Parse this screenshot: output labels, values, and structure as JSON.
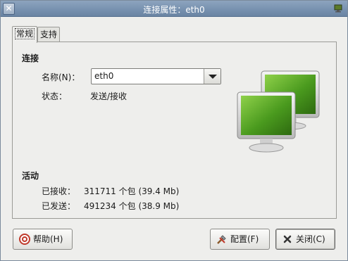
{
  "window": {
    "title": "连接属性：eth0"
  },
  "tabs": [
    {
      "label": "常规",
      "active": true
    },
    {
      "label": "支持",
      "active": false
    }
  ],
  "connection": {
    "section_title": "连接",
    "name_label": "名称(N)：",
    "name_value": "eth0",
    "status_label": "状态：",
    "status_value": "发送/接收"
  },
  "activity": {
    "section_title": "活动",
    "received_label": "已接收：",
    "received_value": "311711 个包 (39.4 Mb)",
    "sent_label": "已发送：",
    "sent_value": "491234 个包 (38.9 Mb)"
  },
  "buttons": {
    "help": "帮助(H)",
    "configure": "配置(F)",
    "close": "关闭(C)"
  },
  "colors": {
    "titlebar": "#7892b0",
    "monitor_screen": "#4a9a1e"
  }
}
